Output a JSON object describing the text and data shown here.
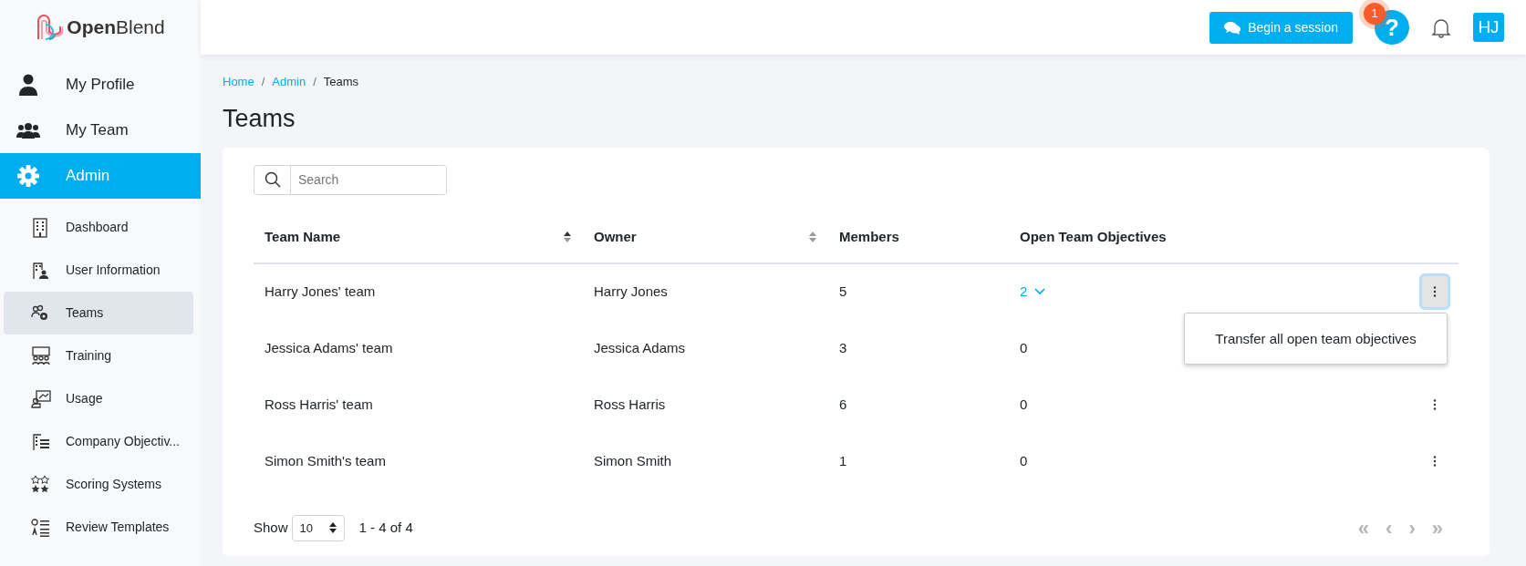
{
  "brand": {
    "name": "**Open**Blend"
  },
  "header": {
    "session_button": "Begin a session",
    "help": {
      "label": "?",
      "badge": "1"
    },
    "avatar": "HJ"
  },
  "sidebar": {
    "items": [
      {
        "label": "My Profile",
        "kind": "person",
        "selected": false
      },
      {
        "label": "My Team",
        "kind": "people",
        "selected": false
      },
      {
        "label": "Admin",
        "kind": "gear",
        "selected": true
      }
    ],
    "submenu": [
      {
        "label": "Dashboard",
        "kind": "building",
        "selected": false
      },
      {
        "label": "User Information",
        "kind": "user-building",
        "selected": false
      },
      {
        "label": "Teams",
        "kind": "team-gear",
        "selected": true
      },
      {
        "label": "Training",
        "kind": "training",
        "selected": false
      },
      {
        "label": "Usage",
        "kind": "usage",
        "selected": false
      },
      {
        "label": "Company Objectiv...",
        "kind": "list-building",
        "selected": false
      },
      {
        "label": "Scoring Systems",
        "kind": "stars",
        "selected": false
      },
      {
        "label": "Review Templates",
        "kind": "qa",
        "selected": false
      }
    ]
  },
  "breadcrumb": [
    {
      "label": "Home",
      "current": false
    },
    {
      "separator": "/",
      "label": "Admin",
      "current": false
    },
    {
      "separator": "/",
      "label": "Teams",
      "current": true
    }
  ],
  "page_title": "Teams",
  "search": {
    "placeholder": "Search"
  },
  "table": {
    "columns": [
      {
        "label": "Team Name",
        "sorted": true
      },
      {
        "label": "Owner",
        "sorted": false
      },
      {
        "label": "Members"
      },
      {
        "label": "Open Team Objectives"
      }
    ],
    "rows": [
      {
        "team": "Harry Jones' team",
        "owner": "Harry Jones",
        "members": "5",
        "objectives": "2",
        "expandable": true,
        "menu_open": true
      },
      {
        "team": "Jessica Adams' team",
        "owner": "Jessica Adams",
        "members": "3",
        "objectives": "0",
        "expandable": false,
        "menu_open": false
      },
      {
        "team": "Ross Harris' team",
        "owner": "Ross Harris",
        "members": "6",
        "objectives": "0",
        "expandable": false,
        "menu_open": false
      },
      {
        "team": "Simon Smith's team",
        "owner": "Simon Smith",
        "members": "1",
        "objectives": "0",
        "expandable": false,
        "menu_open": false
      }
    ]
  },
  "row_menu": {
    "items": [
      "Transfer all open team objectives"
    ]
  },
  "pagination": {
    "show_label": "Show",
    "page_size": "10",
    "range": "1 - 4 of 4",
    "buttons": [
      {
        "label": "«",
        "disabled": true
      },
      {
        "label": "‹",
        "disabled": true
      },
      {
        "label": "›",
        "disabled": true
      },
      {
        "label": "»",
        "disabled": true
      }
    ]
  }
}
